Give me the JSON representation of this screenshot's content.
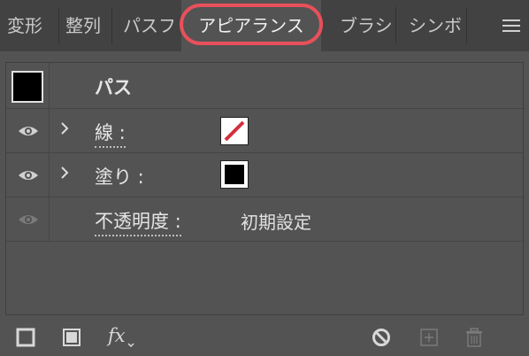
{
  "tabs": [
    {
      "label": "変形"
    },
    {
      "label": "整列"
    },
    {
      "label": "パスフ"
    },
    {
      "label": "アピアランス"
    },
    {
      "label": "ブラシ"
    },
    {
      "label": "シンボ"
    }
  ],
  "panel": {
    "object_label": "パス",
    "rows": [
      {
        "label": "線 :"
      },
      {
        "label": "塗り :"
      },
      {
        "label": "不透明度 :",
        "value": "初期設定"
      }
    ]
  },
  "colors": {
    "highlight": "#e8505b",
    "stroke_slash": "#d32f3f"
  },
  "icons": {
    "menu": "hamburger-menu-icon",
    "eye": "eye-icon",
    "chevron": "chevron-right-icon",
    "add_stroke": "add-stroke-icon",
    "add_fill": "add-fill-icon",
    "fx": "fx-effects-icon",
    "clear": "clear-appearance-icon",
    "duplicate": "duplicate-item-icon",
    "delete": "trash-icon"
  }
}
